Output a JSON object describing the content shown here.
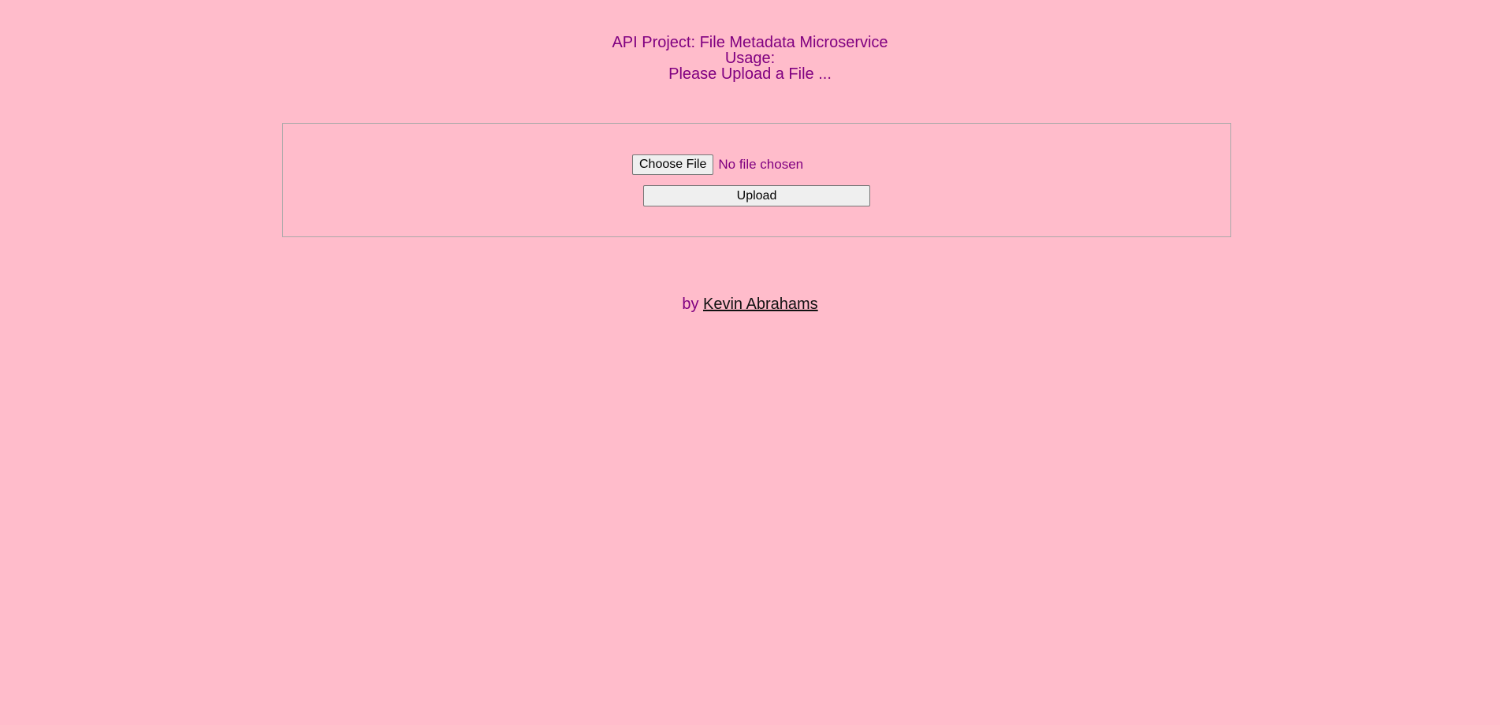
{
  "header": {
    "title": "API Project: File Metadata Microservice",
    "usage_label": "Usage:",
    "instruction": "Please Upload a File ..."
  },
  "upload_form": {
    "choose_file_label": "Choose File",
    "file_status": "No file chosen",
    "upload_label": "Upload"
  },
  "footer": {
    "by_label": "by",
    "author_link": "Kevin Abrahams"
  },
  "colors": {
    "background": "#ffbccb",
    "text": "#800080",
    "link": "#111111"
  }
}
